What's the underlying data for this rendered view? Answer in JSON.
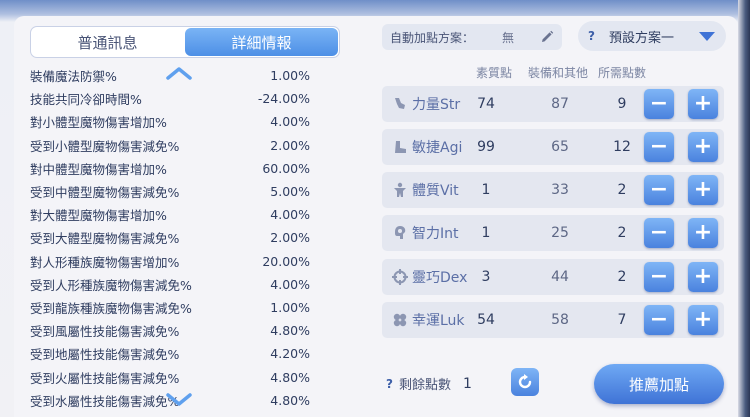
{
  "tabs": [
    {
      "label": "普通訊息",
      "active": false
    },
    {
      "label": "詳細情報",
      "active": true
    }
  ],
  "stats": [
    {
      "label": "裝備魔法防禦%",
      "value": "1.00%"
    },
    {
      "label": "技能共同冷卻時間%",
      "value": "-24.00%"
    },
    {
      "label": "對小體型魔物傷害增加%",
      "value": "4.00%"
    },
    {
      "label": "受到小體型魔物傷害減免%",
      "value": "2.00%"
    },
    {
      "label": "對中體型魔物傷害增加%",
      "value": "60.00%"
    },
    {
      "label": "受到中體型魔物傷害減免%",
      "value": "5.00%"
    },
    {
      "label": "對大體型魔物傷害增加%",
      "value": "4.00%"
    },
    {
      "label": "受到大體型魔物傷害減免%",
      "value": "2.00%"
    },
    {
      "label": "對人形種族魔物傷害增加%",
      "value": "20.00%"
    },
    {
      "label": "受到人形種族魔物傷害減免%",
      "value": "4.00%"
    },
    {
      "label": "受到龍族種族魔物傷害減免%",
      "value": "1.00%"
    },
    {
      "label": "受到風屬性技能傷害減免%",
      "value": "4.80%"
    },
    {
      "label": "受到地屬性技能傷害減免%",
      "value": "4.20%"
    },
    {
      "label": "受到火屬性技能傷害減免%",
      "value": "4.80%"
    },
    {
      "label": "受到水屬性技能傷害減免%",
      "value": "4.80%"
    }
  ],
  "auto_points": {
    "label": "自動加點方案：",
    "value": "無"
  },
  "preset": {
    "q": "?",
    "label": "預設方案一"
  },
  "headers": {
    "base": "素質點",
    "equip": "裝備和其他",
    "cost": "所需點數"
  },
  "attributes": [
    {
      "name": "力量Str",
      "icon": "strength-icon",
      "base": "74",
      "equip": "87",
      "cost": "9"
    },
    {
      "name": "敏捷Agi",
      "icon": "agility-boot-icon",
      "base": "99",
      "equip": "65",
      "cost": "12"
    },
    {
      "name": "體質Vit",
      "icon": "vitality-body-icon",
      "base": "1",
      "equip": "33",
      "cost": "2"
    },
    {
      "name": "智力Int",
      "icon": "intelligence-head-icon",
      "base": "1",
      "equip": "25",
      "cost": "2"
    },
    {
      "name": "靈巧Dex",
      "icon": "dexterity-crosshair-icon",
      "base": "3",
      "equip": "44",
      "cost": "2"
    },
    {
      "name": "幸運Luk",
      "icon": "luck-clover-icon",
      "base": "54",
      "equip": "58",
      "cost": "7"
    }
  ],
  "remaining": {
    "q": "?",
    "label": "剩餘點數",
    "value": "1"
  },
  "recommend_label": "推薦加點",
  "colors": {
    "accent": "#4a82de",
    "accent_light": "#7fb5f6",
    "text": "#2f3d60"
  }
}
